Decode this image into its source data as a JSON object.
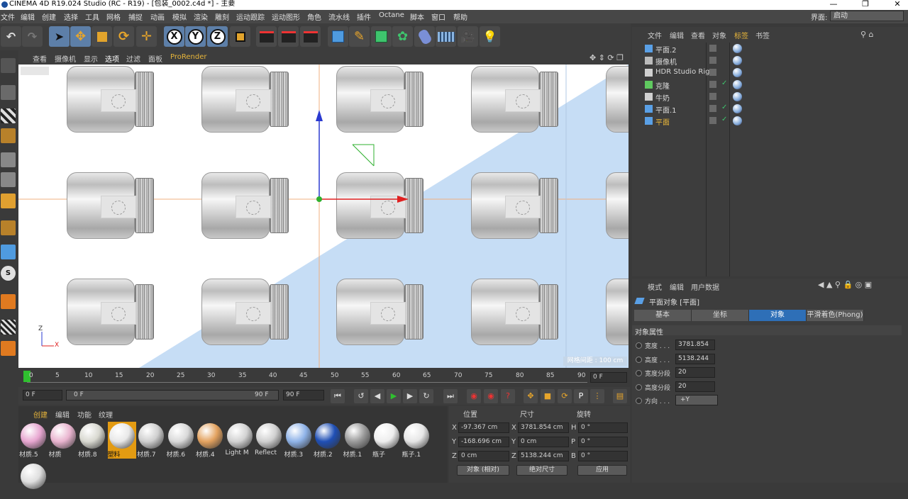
{
  "window": {
    "title": "CINEMA 4D R19.024 Studio (RC - R19) - [包装_0002.c4d *] - 主要",
    "controls": [
      "—",
      "❐",
      "✕"
    ]
  },
  "menubar": {
    "items": [
      "文件",
      "编辑",
      "创建",
      "选择",
      "工具",
      "网格",
      "捕捉",
      "动画",
      "模拟",
      "渲染",
      "雕刻",
      "运动跟踪",
      "运动图形",
      "角色",
      "流水线",
      "插件",
      "Octane",
      "脚本",
      "窗口",
      "帮助"
    ],
    "layout_label": "界面:",
    "layout_value": "启动"
  },
  "viewport": {
    "menu": [
      "查看",
      "摄像机",
      "显示",
      "选项",
      "过滤",
      "面板",
      "ProRender"
    ],
    "scale_label": "网格间距 : 100 cm",
    "axis_labels": {
      "z": "Z",
      "x": "X"
    }
  },
  "timeline": {
    "ticks": [
      "0",
      "5",
      "10",
      "15",
      "20",
      "25",
      "30",
      "35",
      "40",
      "45",
      "50",
      "55",
      "60",
      "65",
      "70",
      "75",
      "80",
      "85",
      "90"
    ],
    "current_frame": "0 F",
    "start_field": "0 F",
    "range_start": "0 F",
    "range_end": "90 F",
    "end_field": "90 F"
  },
  "materials": {
    "menu": [
      "创建",
      "编辑",
      "功能",
      "纹理"
    ],
    "items": [
      {
        "label": "材质.5",
        "color": "#e7a6d0"
      },
      {
        "label": "材质",
        "color": "#e9b4cf"
      },
      {
        "label": "材质.8",
        "color": "#d8d8d0"
      },
      {
        "label": "塑料",
        "color": "#e8e8e8",
        "selected": true
      },
      {
        "label": "材质.7",
        "color": "#cfcfcf"
      },
      {
        "label": "材质.6",
        "color": "#d9d9d9"
      },
      {
        "label": "材质.4",
        "color": "#e3a25f"
      },
      {
        "label": "Light M",
        "color": "#d2d2d2"
      },
      {
        "label": "Reflect",
        "color": "#d0d0d0"
      },
      {
        "label": "材质.3",
        "color": "#8fb3e8"
      },
      {
        "label": "材质.2",
        "color": "#1f4fb5"
      },
      {
        "label": "材质.1",
        "color": "#9a9a9a"
      },
      {
        "label": "瓶子",
        "color": "#eeeeee"
      },
      {
        "label": "瓶子.1",
        "color": "#e6e6e6"
      },
      {
        "label": "",
        "color": "#dedede"
      }
    ]
  },
  "coordinates": {
    "headers": {
      "position": "位置",
      "size": "尺寸",
      "rotation": "旋转"
    },
    "rows": [
      {
        "axis": "X",
        "pos": "-97.367 cm",
        "size_axis": "X",
        "size": "3781.854 cm",
        "rot_axis": "H",
        "rot": "0 °"
      },
      {
        "axis": "Y",
        "pos": "-168.696 cm",
        "size_axis": "Y",
        "size": "0 cm",
        "rot_axis": "P",
        "rot": "0 °"
      },
      {
        "axis": "Z",
        "pos": "0 cm",
        "size_axis": "Z",
        "size": "5138.244 cm",
        "rot_axis": "B",
        "rot": "0 °"
      }
    ],
    "mode_select": "对象 (相对)",
    "size_select": "绝对尺寸",
    "apply_label": "应用"
  },
  "objects": {
    "menu": [
      "文件",
      "编辑",
      "查看",
      "对象",
      "标签",
      "书签"
    ],
    "rows": [
      {
        "name": "平面.2",
        "icon_color": "#5aa0e6",
        "check": false
      },
      {
        "name": "摄像机",
        "icon_color": "#bbbbbb",
        "check": false
      },
      {
        "name": "HDR Studio Rig",
        "icon_color": "#d0d0d0",
        "check": false
      },
      {
        "name": "克隆",
        "icon_color": "#5fc95f",
        "check": true
      },
      {
        "name": "牛奶",
        "icon_color": "#d0d0d0",
        "check": false
      },
      {
        "name": "平面.1",
        "icon_color": "#5aa0e6",
        "check": true
      },
      {
        "name": "平面",
        "icon_color": "#5aa0e6",
        "check": true,
        "selected": true
      }
    ]
  },
  "attributes": {
    "menu": [
      "模式",
      "编辑",
      "用户数据"
    ],
    "object_title": "平面对象 [平面]",
    "tabs": [
      "基本",
      "坐标",
      "对象",
      "平滑着色(Phong)"
    ],
    "active_tab": "对象",
    "section_title": "对象属性",
    "fields": [
      {
        "label": "宽度 . . .",
        "value": "3781.854"
      },
      {
        "label": "高度 . . .",
        "value": "5138.244"
      },
      {
        "label": "宽度分段",
        "value": "20"
      },
      {
        "label": "高度分段",
        "value": "20"
      },
      {
        "label": "方向 . . .",
        "value": "+Y"
      }
    ]
  }
}
